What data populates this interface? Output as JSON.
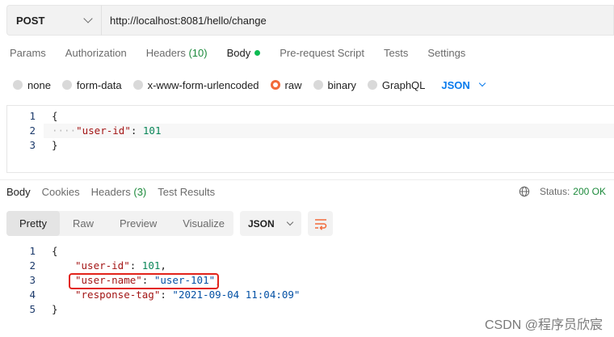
{
  "request": {
    "method": "POST",
    "url": "http://localhost:8081/hello/change"
  },
  "request_tabs": [
    {
      "label": "Params"
    },
    {
      "label": "Authorization"
    },
    {
      "label": "Headers",
      "count": "(10)"
    },
    {
      "label": "Body"
    },
    {
      "label": "Pre-request Script"
    },
    {
      "label": "Tests"
    },
    {
      "label": "Settings"
    }
  ],
  "body_types": [
    {
      "label": "none",
      "checked": false
    },
    {
      "label": "form-data",
      "checked": false
    },
    {
      "label": "x-www-form-urlencoded",
      "checked": false
    },
    {
      "label": "raw",
      "checked": true
    },
    {
      "label": "binary",
      "checked": false
    },
    {
      "label": "GraphQL",
      "checked": false
    }
  ],
  "raw_format": "JSON",
  "request_body_lines": [
    {
      "n": "1",
      "text": "{"
    },
    {
      "n": "2",
      "key": "\"user-id\"",
      "sep": ": ",
      "value": "101"
    },
    {
      "n": "3",
      "text": "}"
    }
  ],
  "response_tabs": [
    {
      "label": "Body"
    },
    {
      "label": "Cookies"
    },
    {
      "label": "Headers",
      "count": "(3)"
    },
    {
      "label": "Test Results"
    }
  ],
  "status": {
    "label": "Status:",
    "value": "200 OK"
  },
  "view_tabs": [
    "Pretty",
    "Raw",
    "Preview",
    "Visualize"
  ],
  "response_format": "JSON",
  "response_body_lines": [
    {
      "n": "1",
      "text": "{"
    },
    {
      "n": "2",
      "key": "\"user-id\"",
      "sep": ": ",
      "value": "101",
      "trail": ","
    },
    {
      "n": "3",
      "key": "\"user-name\"",
      "sep": ": ",
      "value": "\"user-101\"",
      "trail": ","
    },
    {
      "n": "4",
      "key": "\"response-tag\"",
      "sep": ": ",
      "value": "\"2021-09-04 11:04:09\"",
      "trail": ""
    },
    {
      "n": "5",
      "text": "}"
    }
  ],
  "watermark": "CSDN @程序员欣宸",
  "colors": {
    "accent_orange": "#f26b3a",
    "status_green": "#1d8a3c",
    "link_blue": "#097bed",
    "highlight_red": "#e2231a"
  }
}
